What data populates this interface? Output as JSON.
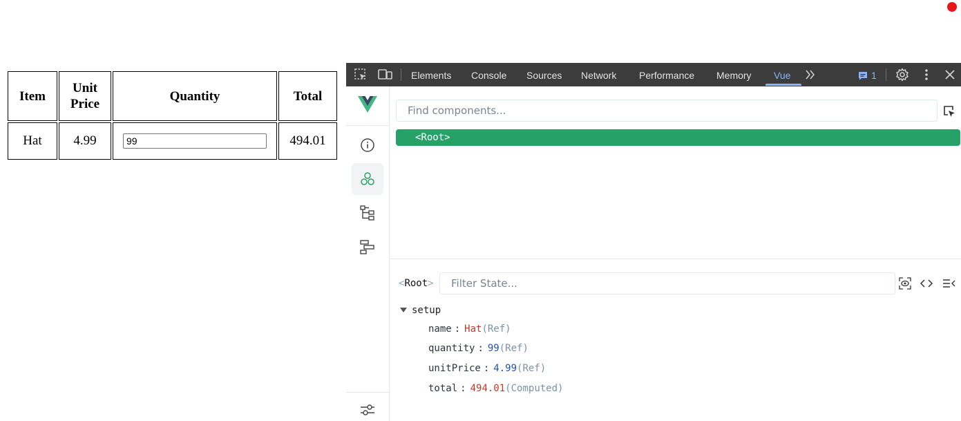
{
  "table": {
    "headers": [
      {
        "line1": "Item",
        "line2": ""
      },
      {
        "line1": "Unit",
        "line2": "Price"
      },
      {
        "line1": "Quantity",
        "line2": ""
      },
      {
        "line1": "Total",
        "line2": ""
      }
    ],
    "row": {
      "item": "Hat",
      "unit_price": "4.99",
      "quantity_value": "99",
      "total": "494.01"
    }
  },
  "devtools": {
    "tabs": [
      "Elements",
      "Console",
      "Sources",
      "Network",
      "Performance",
      "Memory",
      "Vue"
    ],
    "active_tab": "Vue",
    "issues_count": "1",
    "colors": {
      "toolbar_bg": "#3c3c3c",
      "active_tab": "#8ab4f8",
      "vue_green": "#26a269"
    },
    "icons": [
      "inspect-element-icon",
      "device-toolbar-icon",
      "more-tabs-icon",
      "issues-icon",
      "settings-icon",
      "kebab-menu-icon",
      "close-icon"
    ]
  },
  "vue": {
    "sidebar_icons": [
      "vue-logo-icon",
      "info-icon",
      "components-icon",
      "component-tree-icon",
      "timeline-icon",
      "settings-sliders-icon"
    ],
    "search_placeholder": "Find components...",
    "tree_root": "<Root>",
    "state_root_label": "Root",
    "filter_placeholder": "Filter State...",
    "section": "setup",
    "state": [
      {
        "key": "name",
        "value": "Hat",
        "type": "(Ref)",
        "value_color": "red"
      },
      {
        "key": "quantity",
        "value": "99",
        "type": "(Ref)",
        "value_color": "blue"
      },
      {
        "key": "unitPrice",
        "value": "4.99",
        "type": "(Ref)",
        "value_color": "blue"
      },
      {
        "key": "total",
        "value": "494.01",
        "type": "(Computed)",
        "value_color": "red"
      }
    ]
  }
}
